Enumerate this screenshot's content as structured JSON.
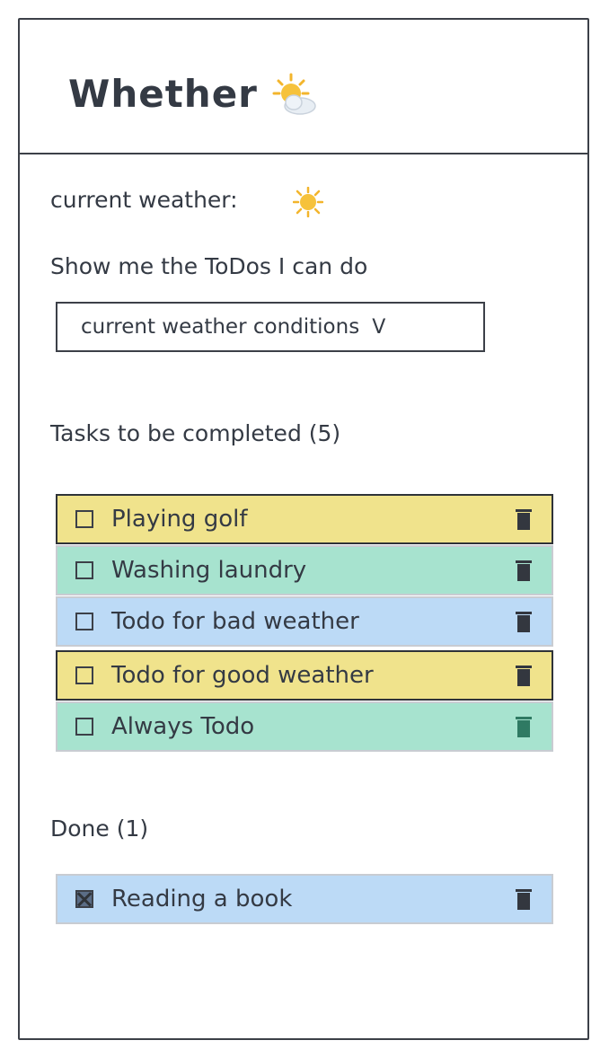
{
  "app": {
    "title": "Whether"
  },
  "weather": {
    "label": "current weather:"
  },
  "filter": {
    "prompt": "Show me the ToDos I can do",
    "selected": "current weather conditions",
    "chevron": "V"
  },
  "tasks": {
    "heading": "Tasks to be completed (5)",
    "items": [
      {
        "label": "Playing golf",
        "color": "#f0e38c"
      },
      {
        "label": "Washing laundry",
        "color": "#a7e3cf"
      },
      {
        "label": "Todo for bad weather",
        "color": "#bcdaf6"
      },
      {
        "label": "Todo for good weather",
        "color": "#f0e38c"
      },
      {
        "label": "Always Todo",
        "color": "#a7e3cf"
      }
    ]
  },
  "done": {
    "heading": "Done (1)",
    "items": [
      {
        "label": "Reading a book",
        "color": "#bcdaf6",
        "checked": true
      }
    ]
  },
  "icons": {
    "title_icon": "sun-behind-cloud-icon",
    "weather_icon": "sun-icon",
    "checkbox": "checkbox-icon",
    "delete": "trash-icon"
  }
}
